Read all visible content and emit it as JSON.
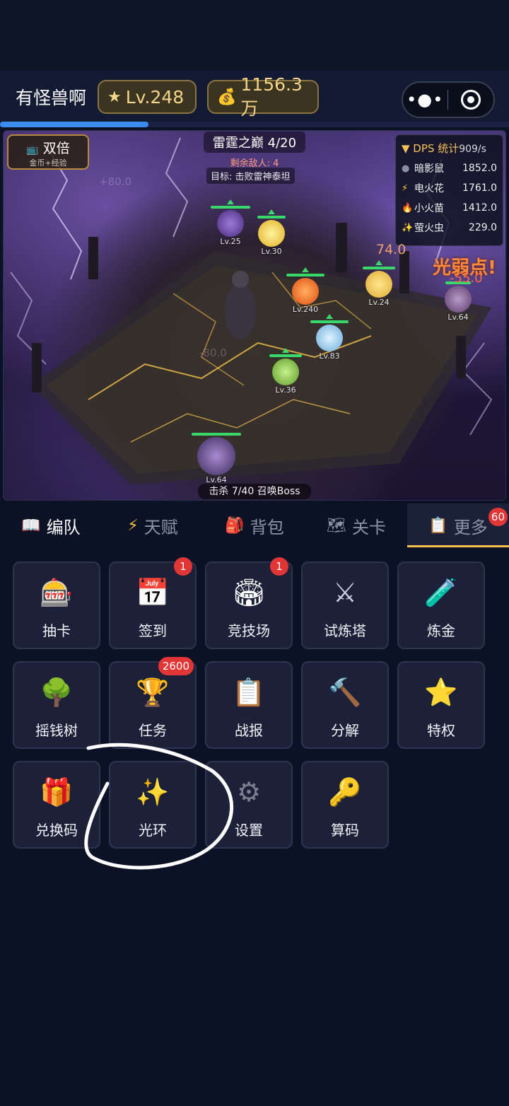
{
  "header": {
    "title": "有怪兽啊",
    "level": "Lv.248",
    "gold": "1156.3万",
    "more_icon": "more-dots-icon",
    "close_icon": "target-icon"
  },
  "scene": {
    "double_badge": {
      "title": "双倍",
      "subtitle": "金币+经验"
    },
    "stage_title": "雷霆之巅 4/20",
    "enemies_left": "剩余敌人: 4",
    "goal": "目标: 击败雷神泰坦",
    "dps": {
      "title": "▼ DPS 统计",
      "rate": "909/s",
      "rows": [
        {
          "icon": "●",
          "name": "暗影鼠",
          "value": "1852.0",
          "color": "#8a8fa8"
        },
        {
          "icon": "⚡",
          "name": "电火花",
          "value": "1761.0",
          "color": "#f5d142"
        },
        {
          "icon": "🔥",
          "name": "小火苗",
          "value": "1412.0",
          "color": "#ff7a2a"
        },
        {
          "icon": "✨",
          "name": "萤火虫",
          "value": "229.0",
          "color": "#f5d142"
        }
      ]
    },
    "monsters": [
      {
        "lv": "Lv.25",
        "color": "#7a5ab8"
      },
      {
        "lv": "Lv.30",
        "color": "#f2d24a"
      },
      {
        "lv": "Lv.240",
        "color": "#ff7a2a"
      },
      {
        "lv": "Lv.24",
        "color": "#f2c84a"
      },
      {
        "lv": "Lv.64",
        "color": "#8a6a9a"
      },
      {
        "lv": "Lv.83",
        "color": "#9ad4f2"
      },
      {
        "lv": "Lv.36",
        "color": "#8ac84a"
      },
      {
        "lv": "Lv.64",
        "color": "#7a5ab8"
      }
    ],
    "weak_point": "光弱点!",
    "weak_value": "-55.0",
    "damage": "74.0",
    "ghost_1": "+80.0",
    "ghost_2": "-80.0",
    "boss_progress": "击杀 7/40 召唤Boss"
  },
  "tabs": [
    {
      "icon": "📖",
      "label": "编队"
    },
    {
      "icon": "⚡",
      "label": "天赋"
    },
    {
      "icon": "🎒",
      "label": "背包"
    },
    {
      "icon": "🗺",
      "label": "关卡"
    },
    {
      "icon": "📋",
      "label": "更多",
      "badge": "60"
    }
  ],
  "grid": [
    {
      "icon": "🎰",
      "label": "抽卡",
      "badge": ""
    },
    {
      "icon": "📅",
      "label": "签到",
      "badge": "1"
    },
    {
      "icon": "🏟",
      "label": "竞技场",
      "badge": "1"
    },
    {
      "icon": "⚔",
      "label": "试炼塔",
      "badge": ""
    },
    {
      "icon": "🧪",
      "label": "炼金",
      "badge": ""
    },
    {
      "icon": "🌳",
      "label": "摇钱树",
      "badge": ""
    },
    {
      "icon": "🏆",
      "label": "任务",
      "badge": "2600"
    },
    {
      "icon": "📋",
      "label": "战报",
      "badge": ""
    },
    {
      "icon": "🔨",
      "label": "分解",
      "badge": ""
    },
    {
      "icon": "⭐",
      "label": "特权",
      "badge": ""
    },
    {
      "icon": "🎁",
      "label": "兑换码",
      "badge": ""
    },
    {
      "icon": "✨",
      "label": "光环",
      "badge": ""
    },
    {
      "icon": "⚙",
      "label": "设置",
      "badge": ""
    },
    {
      "icon": "🔑",
      "label": "算码",
      "badge": ""
    }
  ],
  "colors": {
    "accent": "#f4c04a",
    "badge": "#e23636",
    "tile_bg": "#1c2038"
  }
}
